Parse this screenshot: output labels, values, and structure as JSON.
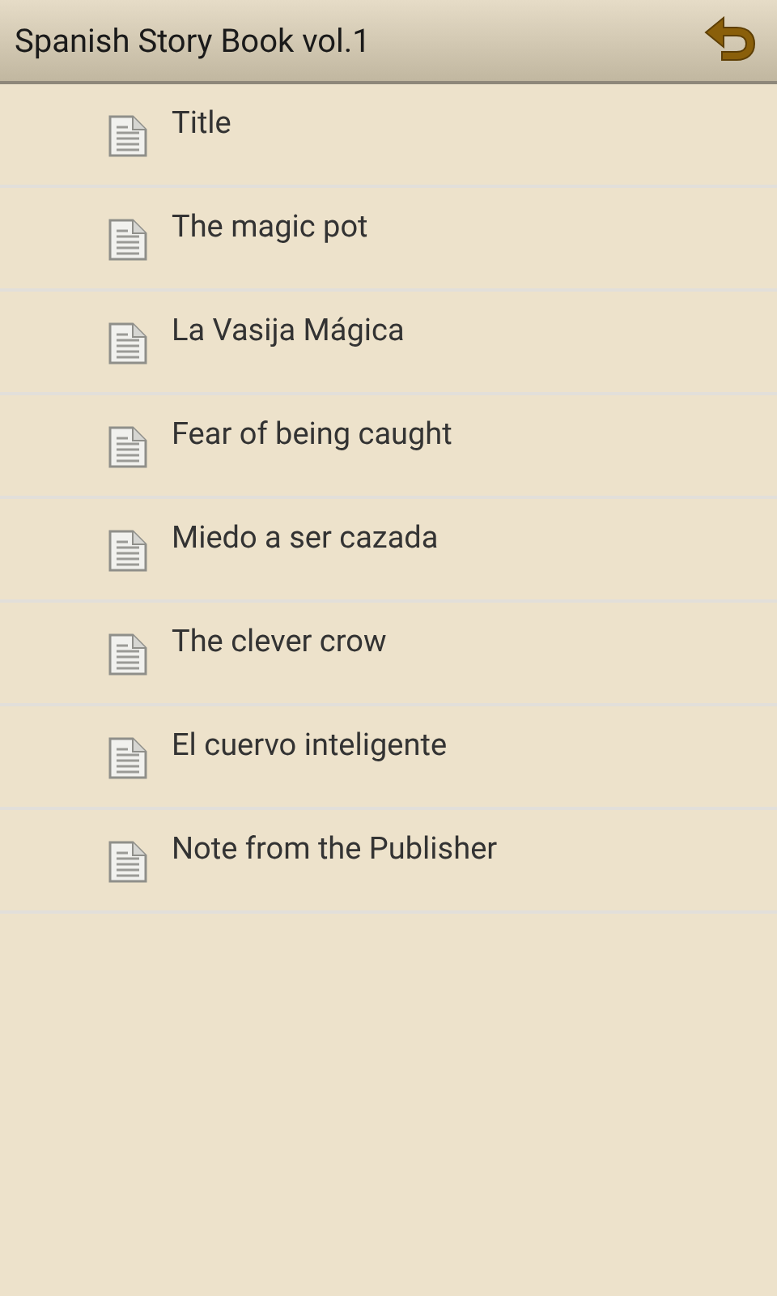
{
  "header": {
    "title": "Spanish Story Book vol.1"
  },
  "chapters": [
    {
      "title": "Title"
    },
    {
      "title": "The magic pot"
    },
    {
      "title": "La Vasija Mágica"
    },
    {
      "title": "Fear of being caught"
    },
    {
      "title": "Miedo a ser cazada"
    },
    {
      "title": "The clever crow"
    },
    {
      "title": "El cuervo inteligente"
    },
    {
      "title": "Note from the Publisher"
    }
  ]
}
